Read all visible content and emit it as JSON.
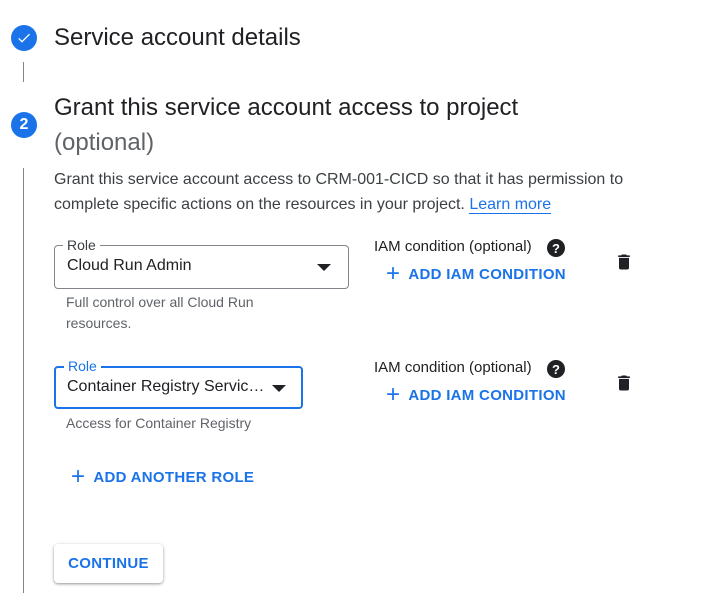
{
  "steps": [
    {
      "number": "",
      "title": "Service account details",
      "state": "completed",
      "icon": "check-icon"
    },
    {
      "number": "2",
      "title": "Grant this service account access to project",
      "subtitle": "(optional)",
      "state": "active"
    }
  ],
  "description": {
    "text": "Grant this service account access to CRM-001-CICD so that it has permission to complete specific actions on the resources in your project.",
    "link": "Learn more"
  },
  "roles": [
    {
      "label": "Role",
      "value": "Cloud Run Admin",
      "hint": "Full control over all Cloud Run resources.",
      "iam_label": "IAM condition (optional)",
      "iam_help_icon": "help-icon",
      "add_condition": "ADD IAM CONDITION",
      "delete_icon": "trash-icon"
    },
    {
      "label": "Role",
      "value": "Container Registry Servic…",
      "hint": "Access for Container Registry",
      "iam_label": "IAM condition (optional)",
      "iam_help_icon": "help-icon",
      "add_condition": "ADD IAM CONDITION",
      "delete_icon": "trash-icon",
      "focused": true
    }
  ],
  "add_another_role": "ADD ANOTHER ROLE",
  "continue_label": "CONTINUE",
  "colors": {
    "accent": "#1a73e8",
    "text": "#202124",
    "secondary": "#5f6368"
  }
}
